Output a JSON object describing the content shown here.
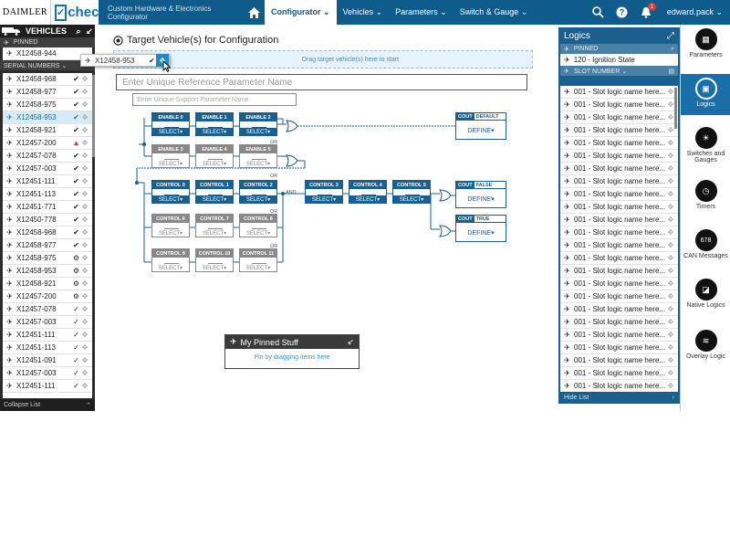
{
  "header": {
    "brand": "DAIMLER",
    "logo_letter": "✓",
    "logo_text": "chec",
    "app_title": "Custom Hardware & Electronics Configurator",
    "nav": [
      {
        "label": "Configurator ⌄"
      },
      {
        "label": "Vehicles ⌄"
      },
      {
        "label": "Parameters ⌄"
      },
      {
        "label": "Switch & Gauge ⌄"
      }
    ],
    "notification_count": "1",
    "user": "edward.pack ⌄"
  },
  "vehicles": {
    "title": "VEHICLES",
    "pinned_label": "PINNED",
    "pinned_item": "X12458-944",
    "serial_label": "SERIAL NUMBERS ⌄",
    "items": [
      {
        "label": "X12458-968",
        "icon": "✔"
      },
      {
        "label": "X12458-977",
        "icon": "✔"
      },
      {
        "label": "X12458-975",
        "icon": "✔"
      },
      {
        "label": "X12458-953",
        "icon": "✔"
      },
      {
        "label": "X12458-921",
        "icon": "✔"
      },
      {
        "label": "X12457-200",
        "icon": "▲"
      },
      {
        "label": "X12457-078",
        "icon": "✔"
      },
      {
        "label": "X12457-003",
        "icon": "✔"
      },
      {
        "label": "X12451-111",
        "icon": "✔"
      },
      {
        "label": "X12451-113",
        "icon": "✔"
      },
      {
        "label": "X12451-771",
        "icon": "✔"
      },
      {
        "label": "X12450-778",
        "icon": "✔"
      },
      {
        "label": "X12458-968",
        "icon": "✔"
      },
      {
        "label": "X12458-977",
        "icon": "✔"
      },
      {
        "label": "X12458-975",
        "icon": "⚙"
      },
      {
        "label": "X12458-953",
        "icon": "⚙"
      },
      {
        "label": "X12458-921",
        "icon": "⚙"
      },
      {
        "label": "X12457-200",
        "icon": "⚙"
      },
      {
        "label": "X12457-078",
        "icon": "✓"
      },
      {
        "label": "X12457-003",
        "icon": "✓"
      },
      {
        "label": "X12451-111",
        "icon": "✓"
      },
      {
        "label": "X12451-113",
        "icon": "✓"
      },
      {
        "label": "X12451-091",
        "icon": "✓"
      },
      {
        "label": "X12457-003",
        "icon": "✓"
      },
      {
        "label": "X12451-111",
        "icon": "✓"
      }
    ],
    "collapse": "Collapse List",
    "drag_item": "X12458-953"
  },
  "main": {
    "title": "Target Vehicle(s) for Configuration",
    "drop_text": "Drag target vehicle(s) here to start",
    "ref_placeholder": "Enter Unique Reference Parameter Name",
    "support_placeholder": "Enter Unique Support Parameter Name",
    "select_label": "SELECT▾",
    "define_label": "DEFINE▾",
    "or": "OR",
    "and": "AND",
    "enable_blocks": [
      "ENABLE 0",
      "ENABLE 1",
      "ENABLE 2",
      "ENABLE 3",
      "ENABLE 4",
      "ENABLE 5"
    ],
    "control_blocks": [
      "CONTROL 0",
      "CONTROL 1",
      "CONTROL 2",
      "CONTROL 3",
      "CONTROL 4",
      "CONTROL 5",
      "CONTROL 6",
      "CONTROL 7",
      "CONTROL 8",
      "CONTROL 9",
      "CONTROL 10",
      "CONTROL 11"
    ],
    "couts": [
      {
        "tag": "COUT",
        "value": "DEFAULT"
      },
      {
        "tag": "COUT",
        "value": "FALSE"
      },
      {
        "tag": "COUT",
        "value": "TRUE"
      }
    ]
  },
  "pinned_stuff": {
    "title": "My Pinned Stuff",
    "hint": "Pin by dragging items here"
  },
  "logics": {
    "title": "Logics",
    "pinned_label": "PINNED",
    "pinned_item": "120 - Ignition State",
    "slot_label": "SLOT NUMBER ⌄",
    "items": [
      "001 - Slot logic name here...",
      "001 - Slot logic name here...",
      "001 - Slot logic name here...",
      "001 - Slot logic name here...",
      "001 - Slot logic name here...",
      "001 - Slot logic name here...",
      "001 - Slot logic name here...",
      "001 - Slot logic name here...",
      "001 - Slot logic name here...",
      "001 - Slot logic name here...",
      "001 - Slot logic name here...",
      "001 - Slot logic name here...",
      "001 - Slot logic name here...",
      "001 - Slot logic name here...",
      "001 - Slot logic name here...",
      "001 - Slot logic name here...",
      "001 - Slot logic name here...",
      "001 - Slot logic name here...",
      "001 - Slot logic name here...",
      "001 - Slot logic name here...",
      "001 - Slot logic name here...",
      "001 - Slot logic name here...",
      "001 - Slot logic name here...",
      "001 - Slot logic name here..."
    ],
    "hide": "Hide List"
  },
  "rail": [
    {
      "label": "Parameters"
    },
    {
      "label": "Logics"
    },
    {
      "label": "Switches and Gauges"
    },
    {
      "label": "Timers"
    },
    {
      "label": "CAN Messages"
    },
    {
      "label": "Native Logics"
    },
    {
      "label": "Overlay Logic"
    }
  ],
  "rail_can_number": "678",
  "colors": {
    "primary": "#0f5b8c",
    "accent": "#1b88c7",
    "warning": "#d62f2f"
  }
}
